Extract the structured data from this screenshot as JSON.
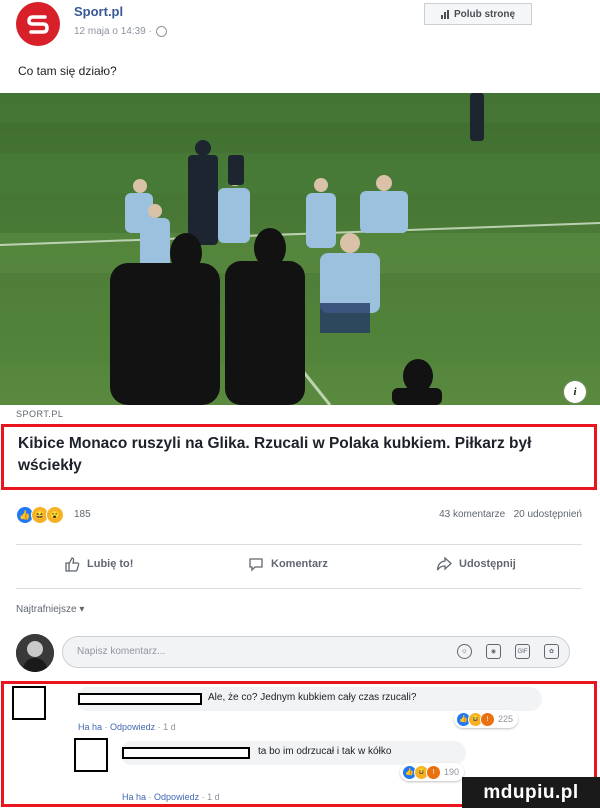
{
  "post": {
    "page_name": "Sport.pl",
    "timestamp": "12 maja o 14:39 ·",
    "like_page_button": "Polub stronę",
    "text": "Co tam się działo?"
  },
  "link": {
    "domain": "SPORT.PL",
    "headline": "Kibice Monaco ruszyli na Glika. Rzucali w Polaka kubkiem. Piłkarz był wściekły"
  },
  "stats": {
    "reaction_count": "185",
    "comments": "43 komentarze",
    "shares": "20 udostępnień"
  },
  "actions": {
    "like": "Lubię to!",
    "comment": "Komentarz",
    "share": "Udostępnij"
  },
  "comments_section": {
    "sort_label": "Najtrafniejsze ▾",
    "input_placeholder": "Napisz komentarz...",
    "input_icons": [
      "emoji-icon",
      "camera-icon",
      "gif-icon",
      "sticker-icon"
    ]
  },
  "comments": [
    {
      "text": "Ale, że co? Jednym kubkiem cały czas rzucali?",
      "haha": "Ha ha",
      "reply": "Odpowiedz",
      "age": "1 d",
      "reaction_count": "225"
    },
    {
      "text": "ta bo im odrzucał i tak w kółko",
      "haha": "Ha ha",
      "reply": "Odpowiedz",
      "age": "1 d",
      "reaction_count": "190"
    }
  ],
  "watermark": "mdupiu.pl",
  "colors": {
    "brand_red": "#d8202a",
    "highlight_red": "#e8141e",
    "link_blue": "#385898",
    "like_blue": "#2078f4",
    "pitch_green": "#4f7f3a"
  }
}
